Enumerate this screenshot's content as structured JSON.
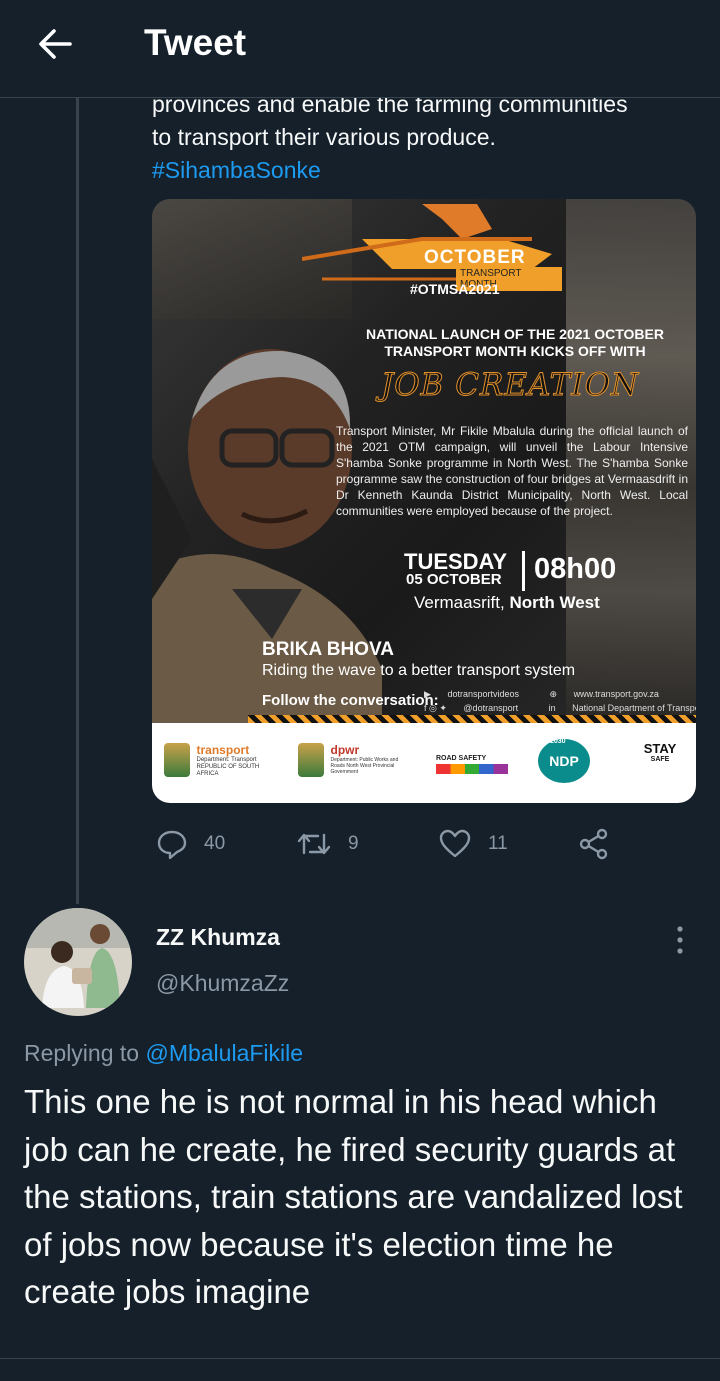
{
  "header": {
    "title": "Tweet",
    "back_icon": "arrow-left-icon"
  },
  "tweet": {
    "text_lines": [
      "provinces and enable the farming communities",
      "to transport their various produce."
    ],
    "hashtag": "#SihambaSonke",
    "media": {
      "badge_month": "OCTOBER",
      "badge_sub": "TRANSPORT MONTH",
      "badge_tag": "#OTMSA2021",
      "headline": "NATIONAL LAUNCH OF THE 2021 OCTOBER TRANSPORT MONTH KICKS OFF WITH",
      "job_creation": "JOB CREATION",
      "body": "Transport Minister, Mr Fikile Mbalula during the official launch of the 2021 OTM campaign, will unveil the Labour Intensive S'hamba Sonke programme in North West. The S'hamba Sonke programme saw the construction of four bridges at Vermaasdrift in Dr Kenneth Kaunda District Municipality, North West. Local communities were employed because of the project.",
      "day": "TUESDAY",
      "date": "05 OCTOBER",
      "time": "08h00",
      "venue_place": "Vermaasrift,",
      "venue_region": "North West",
      "slogan_title": "BRIKA BHOVA",
      "slogan_sub": "Riding the wave to a better transport system",
      "follow": "Follow the conversation:",
      "social_youtube": "dotransportvideos",
      "social_web": "www.transport.gov.za",
      "social_twitter": "@dotransport",
      "social_linkedin": "National Department of Transport",
      "logo_transport_name": "transport",
      "logo_transport_dept": "Department: Transport REPUBLIC OF SOUTH AFRICA",
      "logo_dpwr_name": "dpwr",
      "logo_dpwr_dept": "Department: Public Works and Roads North West Provincial Government",
      "logo_roadsafety": "ROAD SAFETY",
      "logo_ndp": "NDP",
      "logo_ndp_year": "2030",
      "logo_stay": "STAY",
      "logo_stay_sub": "SAFE"
    },
    "actions": {
      "reply_count": "40",
      "retweet_count": "9",
      "like_count": "11"
    }
  },
  "reply": {
    "display_name": "ZZ Khumza",
    "handle": "@KhumzaZz",
    "replying_prefix": "Replying to",
    "replying_to": "@MbalulaFikile",
    "text": "This one he is not normal in his head which job can he create, he fired security guards at the stations, train stations are vandalized lost of jobs now because it's election time he create jobs imagine"
  },
  "colors": {
    "background": "#15202b",
    "accent": "#1d9bf0",
    "muted": "#8b98a5",
    "divider": "#38444d",
    "poster_orange": "#f0a02a"
  }
}
